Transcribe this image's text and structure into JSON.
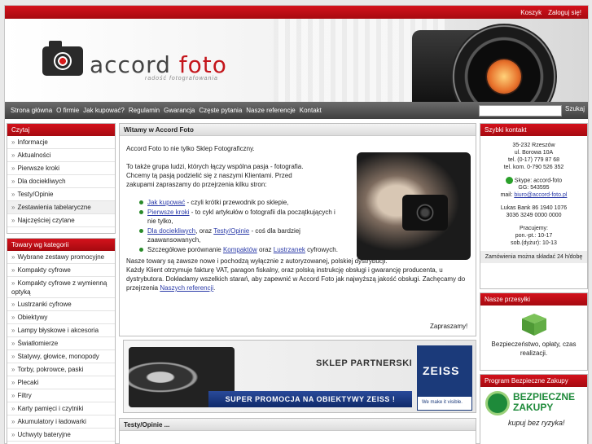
{
  "topbar": {
    "cart": "Koszyk",
    "login": "Zaloguj się!"
  },
  "logo": {
    "text_a": "accord",
    "text_b": " foto",
    "tagline": "radość fotografowania"
  },
  "nav": {
    "items": [
      "Strona główna",
      "O firmie",
      "Jak kupować?",
      "Regulamin",
      "Gwarancja",
      "Częste pytania",
      "Nasze referencje",
      "Kontakt"
    ],
    "search_value": "",
    "search_button": "Szukaj"
  },
  "read_box": {
    "title": "Czytaj",
    "items": [
      "Informacje",
      "Aktualności",
      "Pierwsze kroki",
      "Dla dociekliwych",
      "Testy/Opinie",
      "Zestawienia tabelaryczne",
      "Najczęściej czytane"
    ]
  },
  "category_box": {
    "title": "Towary wg kategorii",
    "items": [
      "Wybrane zestawy promocyjne",
      "Kompakty cyfrowe",
      "Kompakty cyfrowe z wymienną optyką",
      "Lustrzanki cyfrowe",
      "Obiektywy",
      "Lampy błyskowe i akcesoria",
      "Światłomierze",
      "Statywy, głowice, monopody",
      "Torby, pokrowce, paski",
      "Plecaki",
      "Filtry",
      "Karty pamięci i czytniki",
      "Akumulatory i ładowarki",
      "Uchwyty bateryjne"
    ]
  },
  "welcome": {
    "title": "Witamy w Accord Foto",
    "p1": "Accord Foto to nie tylko Sklep Fotograficzny.",
    "p2": "To także grupa ludzi, których łączy wspólna pasja - fotografia. Chcemy tą pasją podzielić się z naszymi Klientami. Przed zakupami zapraszamy do przejrzenia kilku stron:",
    "bullets": [
      {
        "link": "Jak kupować",
        "text": " - czyli krótki przewodnik po sklepie,"
      },
      {
        "link": "Pierwsze kroki",
        "text": " - to cykl artykułów o fotografii dla początkujących i nie tylko,"
      },
      {
        "link": "Dla dociekliwych",
        "text": ", oraz ",
        "link2": "Testy/Opinie",
        "text2": " -  coś dla bardziej zaawansowanych,"
      },
      {
        "text0": "Szczegółowe porównanie ",
        "link": "Kompaktów",
        "text": " oraz ",
        "link2": "Lustrzanek",
        "text2": " cyfrowych."
      }
    ],
    "p3a": "Nasze towary są zawsze nowe i pochodzą wyłącznie z autoryzowanej, polskiej dystrybucji.",
    "p3b": "Każdy Klient otrzymuje fakturę VAT, paragon fiskalny, oraz polską instrukcję obsługi i gwarancję producenta, u dystrybutora.  Dokładamy  wszelkich starań, aby zapewnić w Accord Foto  jak najwyższą jakość obsługi. Zachęcamy do przejrzenia ",
    "p3_link": "Naszych referencji",
    "closing": "Zapraszamy!"
  },
  "banner": {
    "partner": "SKLEP PARTNERSKI",
    "brand": "ZEISS",
    "brand_tag": "We make it visible.",
    "promo": "SUPER PROMOCJA NA OBIEKTYWY ZEISS !"
  },
  "reviews": {
    "title": "Testy/Opinie ..."
  },
  "quick_contact": {
    "title": "Szybki kontakt",
    "address": [
      "35-232 Rzeszów",
      "ul. Borowa 10A",
      "tel. (0-17) 779 87 68",
      "tel. kom. 0-790 526 352"
    ],
    "skype": "Skype:  accord-foto",
    "gg": "GG: 543595",
    "mail_label": "mail: ",
    "mail": "biuro@accord-foto.pl",
    "bank": [
      "Lukas Bank 86 1940 1076",
      "3036 3249 0000 0000"
    ],
    "hours_title": "Pracujemy:",
    "hours": [
      "pon.-pt.: 10-17",
      "sob.(dyżur): 10-13"
    ],
    "order_note": "Zamówienia można składać 24 h/dobę"
  },
  "shipping": {
    "title": "Nasze przesyłki",
    "text": "Bezpieczeństwo, opłaty, czas realizacji."
  },
  "secure": {
    "title": "Program Bezpieczne Zakupy",
    "logo_line1": "BEZPIECZNE",
    "logo_line2": "ZAKUPY",
    "tagline": "kupuj bez ryzyka!"
  },
  "colors": {
    "accent_red": "#c4161c",
    "link_blue": "#2a3aa8",
    "nav_grey": "#505050"
  }
}
